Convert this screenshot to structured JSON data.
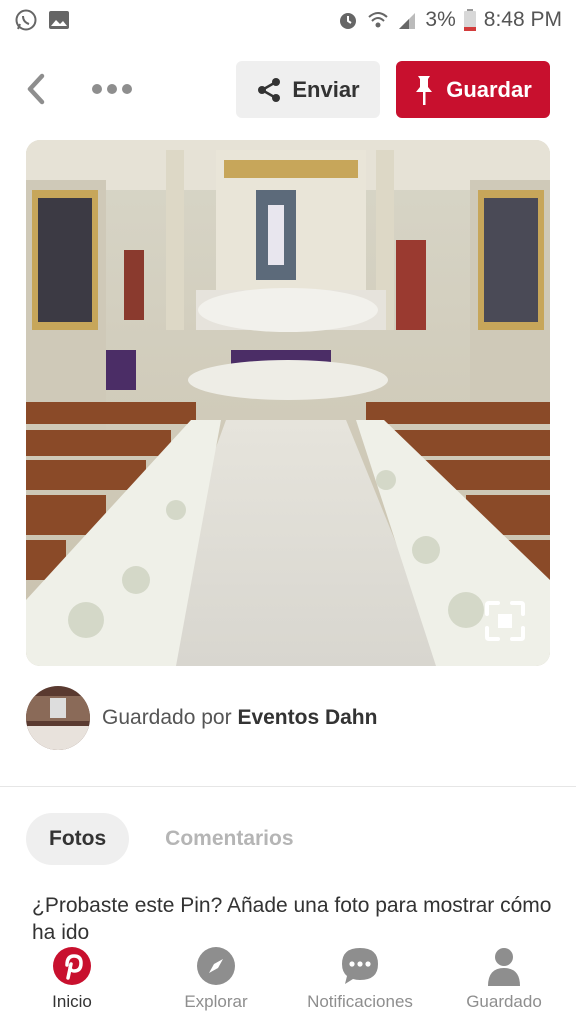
{
  "status_bar": {
    "battery": "3%",
    "time": "8:48 PM",
    "left_icons": [
      "whatsapp-icon",
      "gallery-icon"
    ],
    "right_icons": [
      "alarm-icon",
      "wifi-icon",
      "signal-icon",
      "battery-icon"
    ]
  },
  "top_bar": {
    "send_label": "Enviar",
    "save_label": "Guardar",
    "save_color": "#c8102e"
  },
  "pin": {
    "saved_prefix": "Guardado por",
    "saved_by": "Eventos Dahn"
  },
  "tabs": [
    {
      "label": "Fotos",
      "active": true
    },
    {
      "label": "Comentarios",
      "active": false
    }
  ],
  "prompt": "¿Probaste este Pin? Añade una foto para mostrar cómo ha ido",
  "bottom_nav": [
    {
      "label": "Inicio",
      "icon": "pinterest-logo-icon",
      "active": true
    },
    {
      "label": "Explorar",
      "icon": "compass-icon",
      "active": false
    },
    {
      "label": "Notificaciones",
      "icon": "chat-bubble-icon",
      "active": false
    },
    {
      "label": "Guardado",
      "icon": "person-icon",
      "active": false
    }
  ],
  "colors": {
    "brand_red": "#c8102e",
    "muted_gray": "#8e8e8e"
  }
}
